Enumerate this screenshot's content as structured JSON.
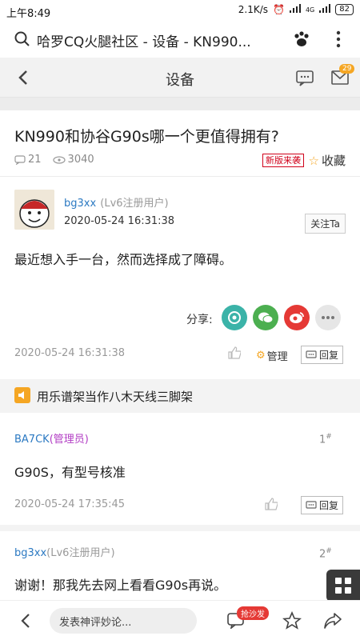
{
  "status_bar": {
    "time": "上午8:49",
    "speed": "2.1K/s",
    "battery": "82",
    "net": "4G"
  },
  "browser": {
    "title": "哈罗CQ火腿社区 - 设备 - KN990..."
  },
  "nav": {
    "title": "设备",
    "message_count": "29"
  },
  "thread": {
    "title": "KN990和协谷G90s哪一个更值得拥有?",
    "replies": "21",
    "views": "3040",
    "new_tag": "新版来袭",
    "favorite": "收藏"
  },
  "post1": {
    "username": "bg3xx",
    "level": "(Lv6注册用户)",
    "datetime": "2020-05-24 16:31:38",
    "follow": "关注Ta",
    "content": "最近想入手一台，然而选择成了障碍。",
    "share_label": "分享:",
    "footer_date": "2020-05-24 16:31:38",
    "manage": "管理",
    "reply": "回复"
  },
  "notice": {
    "text": "用乐谱架当作八木天线三脚架"
  },
  "reply1": {
    "username": "BA7CK",
    "role": "(管理员)",
    "floor": "1",
    "content": "G90S，有型号核准",
    "date": "2020-05-24 17:35:45",
    "reply": "回复"
  },
  "reply2": {
    "username": "bg3xx",
    "level": "(Lv6注册用户)",
    "floor": "2",
    "content": "谢谢！那我先去网上看看G90s再说。"
  },
  "bottom_bar": {
    "placeholder": "发表神评妙论...",
    "hot_badge": "抢沙发"
  },
  "colors": {
    "link": "#2b79c2",
    "admin": "#b23dc4",
    "accent": "#f5a623",
    "alert": "#d0021b"
  }
}
